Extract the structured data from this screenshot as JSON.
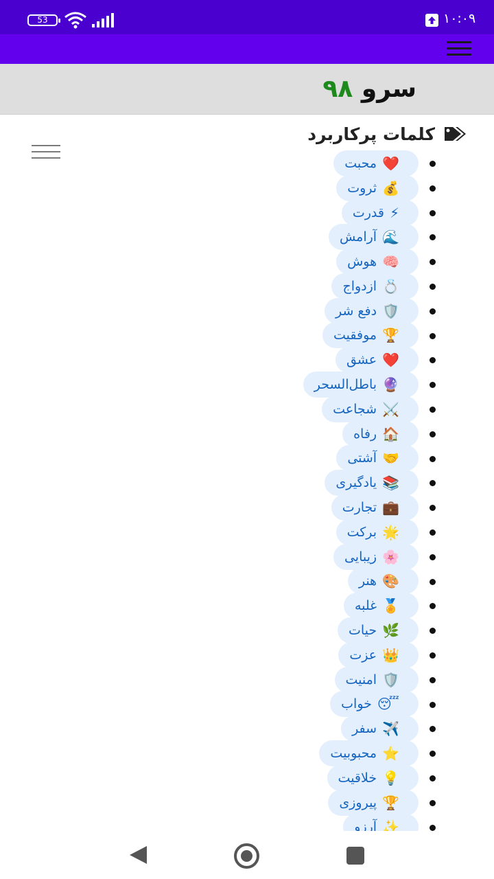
{
  "status_bar": {
    "battery": "53",
    "time": "۱۰:۰۹"
  },
  "header": {
    "logo_name": "سرو",
    "logo_number": "۹۸"
  },
  "section": {
    "title": "کلمات پرکاربرد"
  },
  "tags": [
    {
      "emoji": "❤️",
      "label": "محبت"
    },
    {
      "emoji": "💰",
      "label": "ثروت"
    },
    {
      "emoji": "⚡",
      "label": "قدرت"
    },
    {
      "emoji": "🌊",
      "label": "آرامش"
    },
    {
      "emoji": "🧠",
      "label": "هوش"
    },
    {
      "emoji": "💍",
      "label": "ازدواج"
    },
    {
      "emoji": "🛡️",
      "label": "دفع شر"
    },
    {
      "emoji": "🏆",
      "label": "موفقیت"
    },
    {
      "emoji": "❤️",
      "label": "عشق"
    },
    {
      "emoji": "🔮",
      "label": "باطل‌السحر"
    },
    {
      "emoji": "⚔️",
      "label": "شجاعت"
    },
    {
      "emoji": "🏠",
      "label": "رفاه"
    },
    {
      "emoji": "🤝",
      "label": "آشتی"
    },
    {
      "emoji": "📚",
      "label": "یادگیری"
    },
    {
      "emoji": "💼",
      "label": "تجارت"
    },
    {
      "emoji": "🌟",
      "label": "برکت"
    },
    {
      "emoji": "🌸",
      "label": "زیبایی"
    },
    {
      "emoji": "🎨",
      "label": "هنر"
    },
    {
      "emoji": "🏅",
      "label": "غلبه"
    },
    {
      "emoji": "🌿",
      "label": "حیات"
    },
    {
      "emoji": "👑",
      "label": "عزت"
    },
    {
      "emoji": "🛡️",
      "label": "امنیت"
    },
    {
      "emoji": "😴",
      "label": "خواب"
    },
    {
      "emoji": "✈️",
      "label": "سفر"
    },
    {
      "emoji": "⭐",
      "label": "محبوبیت"
    },
    {
      "emoji": "💡",
      "label": "خلاقیت"
    },
    {
      "emoji": "🏆",
      "label": "پیروزی"
    },
    {
      "emoji": "✨",
      "label": "آرزو"
    }
  ]
}
